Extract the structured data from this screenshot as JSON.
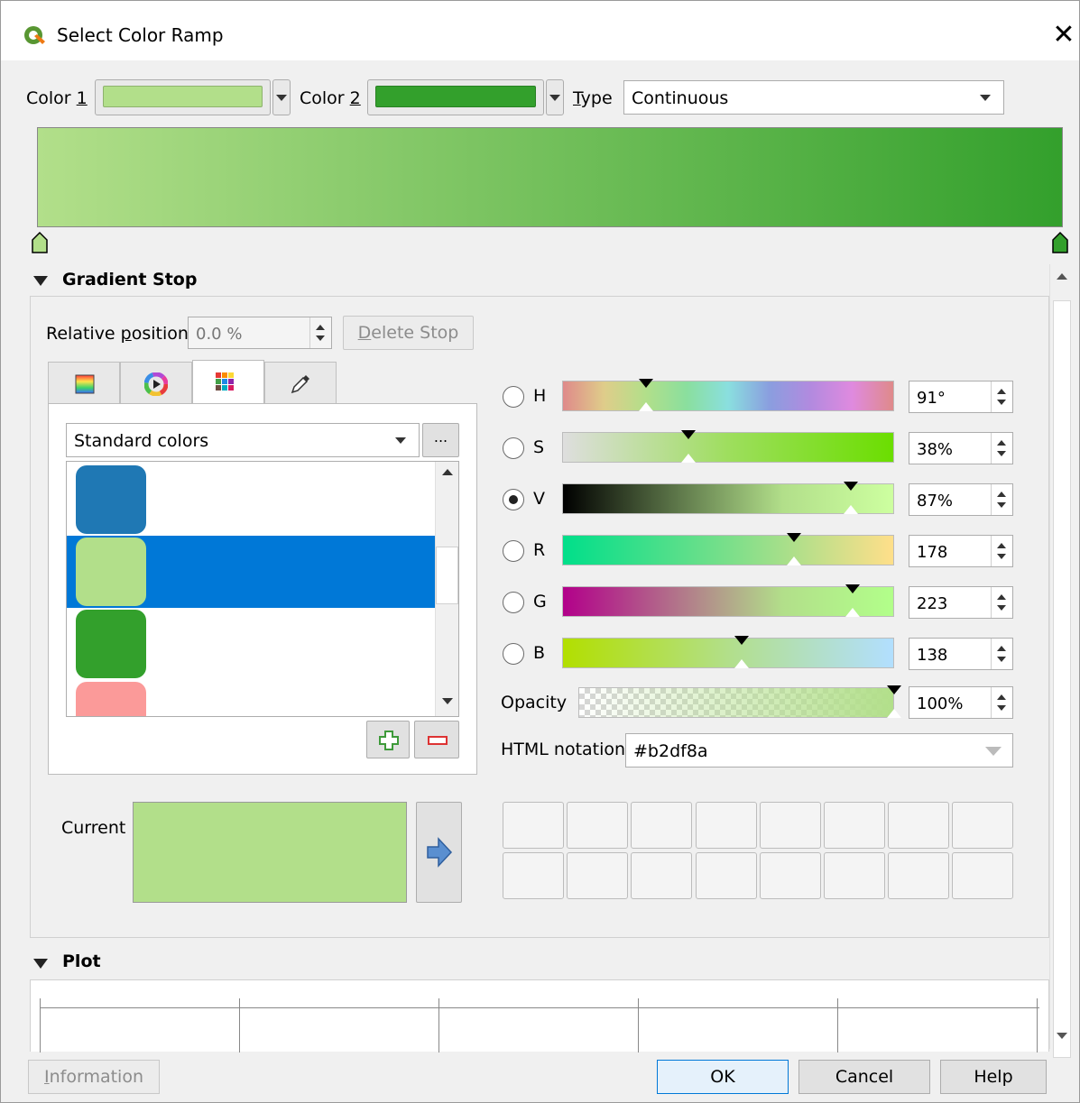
{
  "window": {
    "title": "Select Color Ramp",
    "close_symbol": "✕"
  },
  "top_row": {
    "color1_label": "Color ",
    "color1_accel": "1",
    "color1_value": "#b2df8a",
    "color2_label": "Color ",
    "color2_accel": "2",
    "color2_value": "#33a02c",
    "type_label_accel": "T",
    "type_label_rest": "ype",
    "type_value": "Continuous"
  },
  "ramp": {
    "start_color": "#b2df8a",
    "end_color": "#33a02c"
  },
  "gradient_stop": {
    "header": "Gradient Stop",
    "relative_position_label_a": "Relative ",
    "relative_position_label_accel": "p",
    "relative_position_label_b": "osition",
    "relative_position_value": "0.0 %",
    "delete_stop_accel": "D",
    "delete_stop_rest": "elete Stop"
  },
  "swatches": {
    "scheme": "Standard colors",
    "more_button": "...",
    "items": [
      {
        "color": "#1f78b4"
      },
      {
        "color": "#b2df8a"
      },
      {
        "color": "#33a02c"
      },
      {
        "color": "#fb9a99"
      }
    ],
    "selected_index": 1
  },
  "channels": [
    {
      "key": "h",
      "label": "H",
      "value": "91°",
      "level": 0.253
    },
    {
      "key": "s",
      "label": "S",
      "value": "38%",
      "level": 0.38
    },
    {
      "key": "v",
      "label": "V",
      "value": "87%",
      "level": 0.87,
      "checked": true
    },
    {
      "key": "r",
      "label": "R",
      "value": "178",
      "level": 0.698
    },
    {
      "key": "g",
      "label": "G",
      "value": "223",
      "level": 0.875
    },
    {
      "key": "b",
      "label": "B",
      "value": "138",
      "level": 0.541
    }
  ],
  "opacity": {
    "label": "Opacity",
    "value": "100%",
    "level": 1.0
  },
  "html_notation": {
    "label": "HTML notation",
    "value": "#b2df8a"
  },
  "current": {
    "label": "Current",
    "color": "#b2df8a"
  },
  "plot": {
    "header": "Plot"
  },
  "buttons": {
    "information_accel": "I",
    "information_rest": "nformation",
    "ok": "OK",
    "cancel": "Cancel",
    "help": "Help"
  },
  "colors": {
    "accent": "#0078d7",
    "selection": "#0078d7"
  }
}
